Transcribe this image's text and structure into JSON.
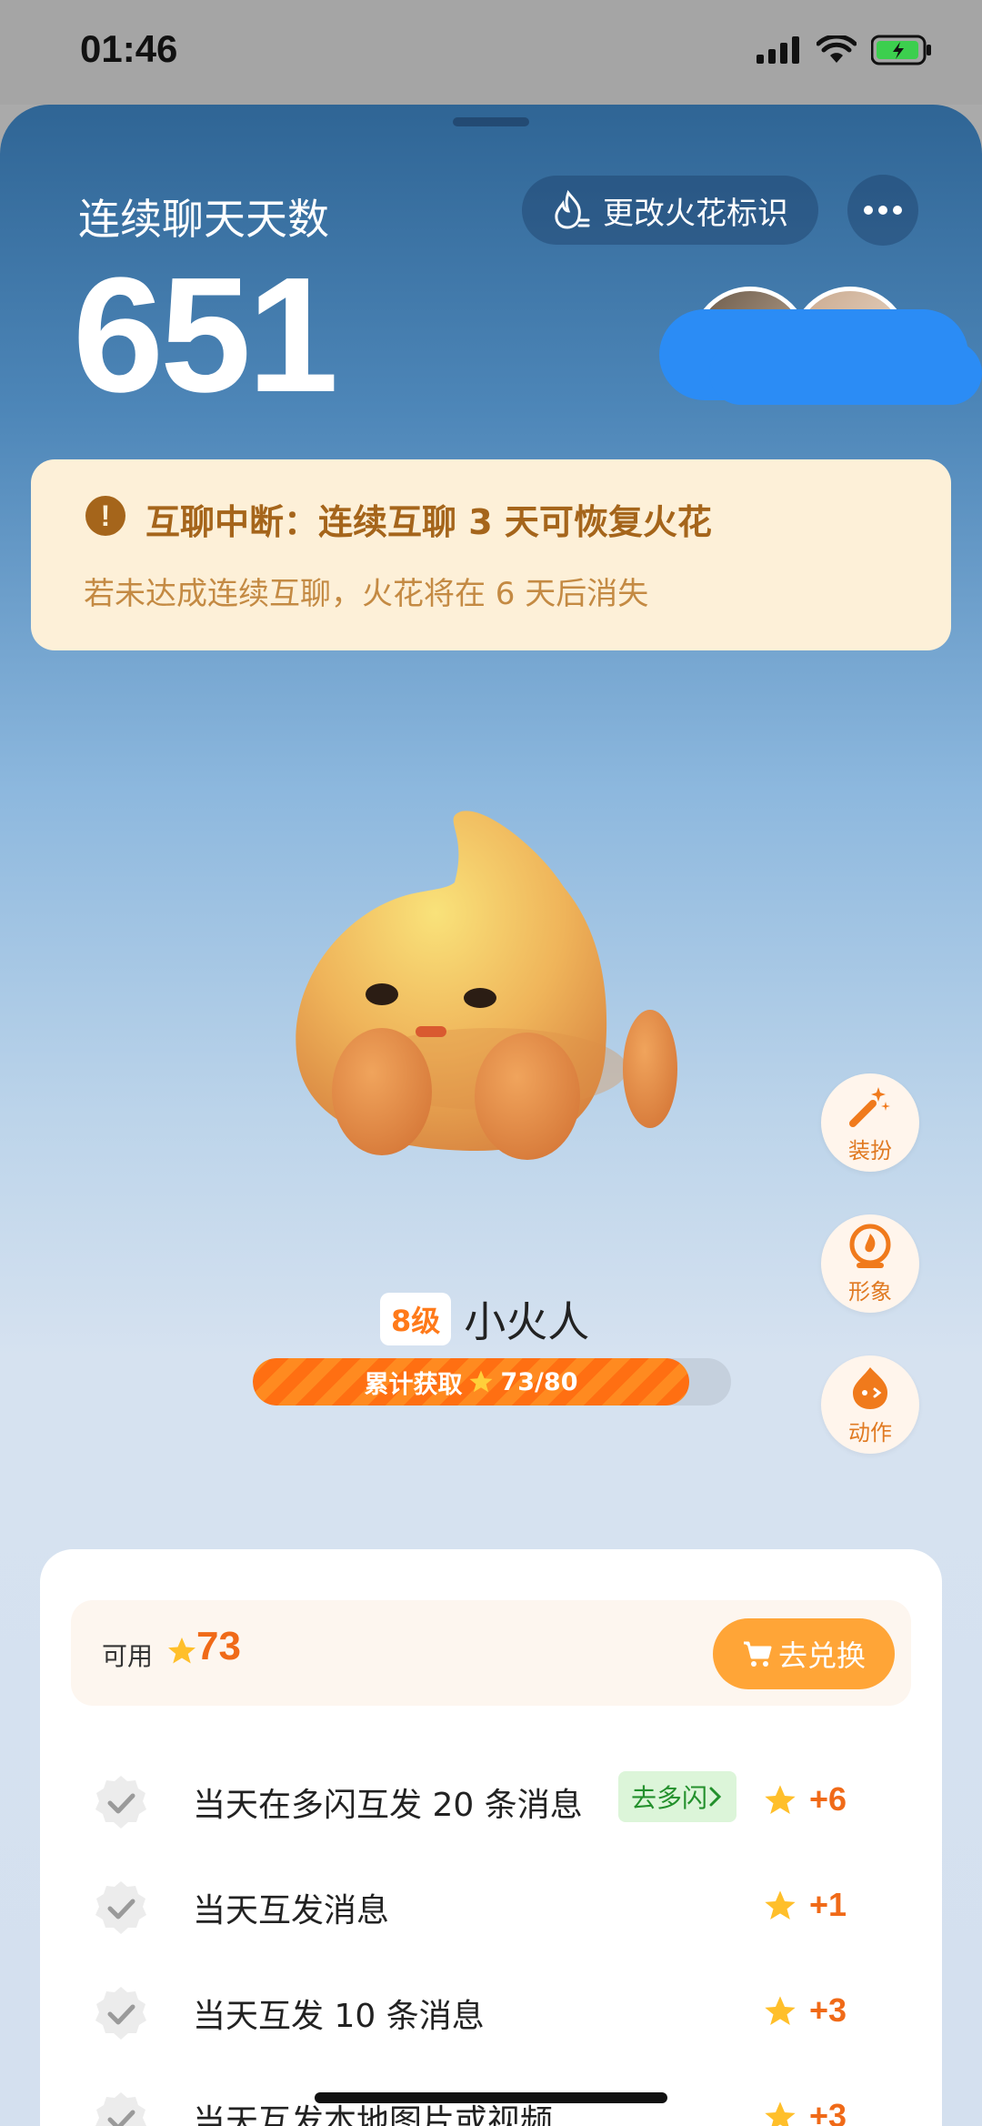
{
  "status_bar": {
    "time": "01:46"
  },
  "header": {
    "streak_label": "连续聊天天数",
    "streak_count": "651",
    "change_mark_label": "更改火花标识"
  },
  "alert": {
    "title": "互聊中断：连续互聊 3 天可恢复火花",
    "subtitle": "若未达成连续互聊，火花将在 6 天后消失"
  },
  "side_buttons": [
    {
      "label": "装扮",
      "icon": "magic-wand-icon"
    },
    {
      "label": "形象",
      "icon": "flame-badge-icon"
    },
    {
      "label": "动作",
      "icon": "mascot-face-icon"
    }
  ],
  "level": {
    "badge": "8级",
    "name": "小火人",
    "progress_label": "累计获取",
    "progress_value": "73/80",
    "progress_fraction": 0.9125
  },
  "points": {
    "label": "可用",
    "value": "73",
    "redeem_label": "去兑换"
  },
  "tasks": [
    {
      "text": "当天在多闪互发 20 条消息",
      "link": "去多闪",
      "reward": "+6"
    },
    {
      "text": "当天互发消息",
      "reward": "+1"
    },
    {
      "text": "当天互发 10 条消息",
      "reward": "+3"
    },
    {
      "text": "当天互发本地图片或视频",
      "reward": "+3"
    }
  ],
  "colors": {
    "accent": "#F06A18",
    "alert_bg": "#FDF0D8",
    "alert_text": "#A5651B",
    "link_green": "#23902C"
  }
}
